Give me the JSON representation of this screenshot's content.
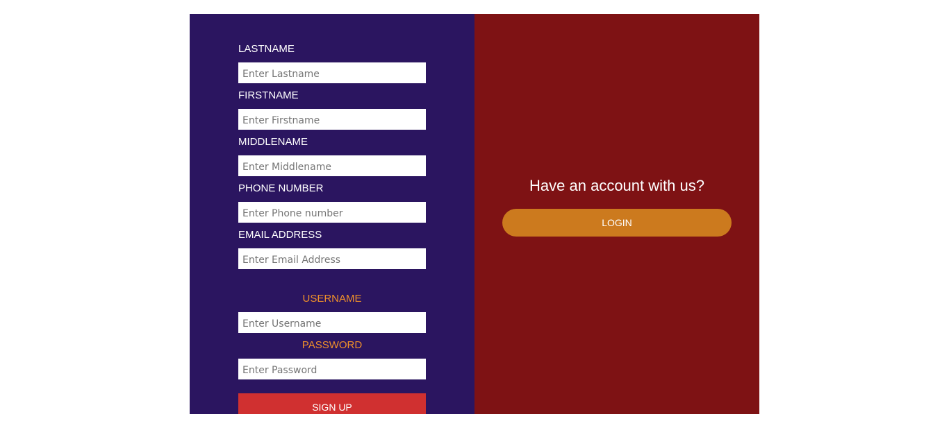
{
  "form": {
    "lastname": {
      "label": "LASTNAME",
      "placeholder": "Enter Lastname"
    },
    "firstname": {
      "label": "FIRSTNAME",
      "placeholder": "Enter Firstname"
    },
    "middlename": {
      "label": "MIDDLENAME",
      "placeholder": "Enter Middlename"
    },
    "phone": {
      "label": "PHONE NUMBER",
      "placeholder": "Enter Phone number"
    },
    "email": {
      "label": "EMAIL ADDRESS",
      "placeholder": "Enter Email Address"
    },
    "username": {
      "label": "USERNAME",
      "placeholder": "Enter Username"
    },
    "password": {
      "label": "PASSWORD",
      "placeholder": "Enter Password"
    },
    "signup_label": "SIGN UP"
  },
  "login_panel": {
    "heading": "Have an account with us?",
    "login_label": "LOGIN"
  },
  "colors": {
    "left_panel_bg": "#2b1560",
    "right_panel_bg": "#7e1214",
    "accent_label": "#f0902a",
    "signup_button": "#d03030",
    "login_button": "#cc7a1e"
  }
}
